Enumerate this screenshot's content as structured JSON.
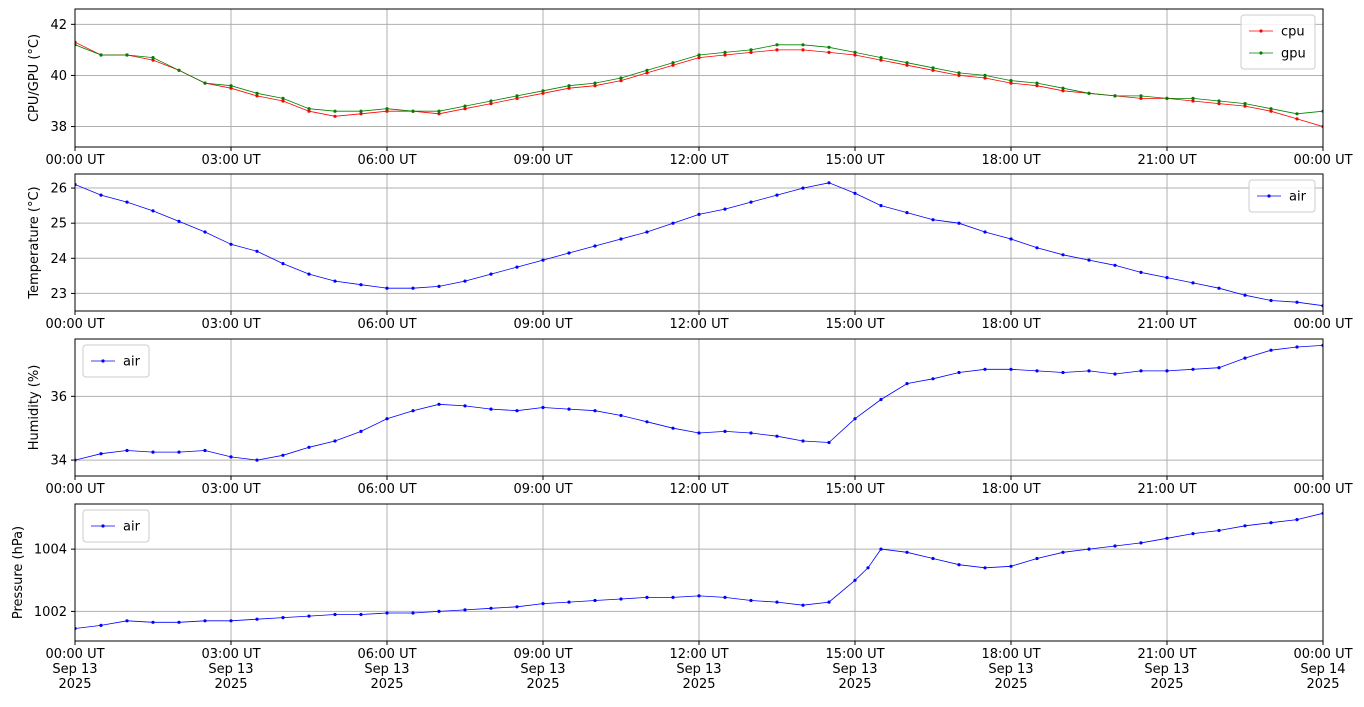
{
  "chart_data": [
    {
      "type": "line",
      "ylabel": "CPU/GPU (°C)",
      "ylim": [
        37.2,
        42.6
      ],
      "yticks": [
        38,
        40,
        42
      ],
      "x_range": [
        "2025-09-13 00:00 UT",
        "2025-09-14 00:00 UT"
      ],
      "x_ticks": [
        "00:00 UT",
        "03:00 UT",
        "06:00 UT",
        "09:00 UT",
        "12:00 UT",
        "15:00 UT",
        "18:00 UT",
        "21:00 UT",
        "00:00 UT"
      ],
      "grid": true,
      "legend": "upper right",
      "series": [
        {
          "name": "cpu",
          "color": "#ff0000",
          "hours": [
            0,
            0.5,
            1,
            1.5,
            2,
            2.5,
            3,
            3.5,
            4,
            4.5,
            5,
            5.5,
            6,
            6.5,
            7,
            7.5,
            8,
            8.5,
            9,
            9.5,
            10,
            10.5,
            11,
            11.5,
            12,
            12.5,
            13,
            13.5,
            14,
            14.5,
            15,
            15.5,
            16,
            16.5,
            17,
            17.5,
            18,
            18.5,
            19,
            19.5,
            20,
            20.5,
            21,
            21.5,
            22,
            22.5,
            23,
            23.5,
            24
          ],
          "values": [
            41.3,
            40.8,
            40.8,
            40.6,
            40.2,
            39.7,
            39.5,
            39.2,
            39.0,
            38.6,
            38.4,
            38.5,
            38.6,
            38.6,
            38.5,
            38.7,
            38.9,
            39.1,
            39.3,
            39.5,
            39.6,
            39.8,
            40.1,
            40.4,
            40.7,
            40.8,
            40.9,
            41.0,
            41.0,
            40.9,
            40.8,
            40.6,
            40.4,
            40.2,
            40.0,
            39.9,
            39.7,
            39.6,
            39.4,
            39.3,
            39.2,
            39.1,
            39.1,
            39.0,
            38.9,
            38.8,
            38.6,
            38.3,
            38.0
          ]
        },
        {
          "name": "gpu",
          "color": "#008000",
          "hours": [
            0,
            0.5,
            1,
            1.5,
            2,
            2.5,
            3,
            3.5,
            4,
            4.5,
            5,
            5.5,
            6,
            6.5,
            7,
            7.5,
            8,
            8.5,
            9,
            9.5,
            10,
            10.5,
            11,
            11.5,
            12,
            12.5,
            13,
            13.5,
            14,
            14.5,
            15,
            15.5,
            16,
            16.5,
            17,
            17.5,
            18,
            18.5,
            19,
            19.5,
            20,
            20.5,
            21,
            21.5,
            22,
            22.5,
            23,
            23.5,
            24
          ],
          "values": [
            41.2,
            40.8,
            40.8,
            40.7,
            40.2,
            39.7,
            39.6,
            39.3,
            39.1,
            38.7,
            38.6,
            38.6,
            38.7,
            38.6,
            38.6,
            38.8,
            39.0,
            39.2,
            39.4,
            39.6,
            39.7,
            39.9,
            40.2,
            40.5,
            40.8,
            40.9,
            41.0,
            41.2,
            41.2,
            41.1,
            40.9,
            40.7,
            40.5,
            40.3,
            40.1,
            40.0,
            39.8,
            39.7,
            39.5,
            39.3,
            39.2,
            39.2,
            39.1,
            39.1,
            39.0,
            38.9,
            38.7,
            38.5,
            38.6
          ]
        }
      ]
    },
    {
      "type": "line",
      "ylabel": "Temperature (°C)",
      "ylim": [
        22.5,
        26.4
      ],
      "yticks": [
        23,
        24,
        25,
        26
      ],
      "x_range": [
        "2025-09-13 00:00 UT",
        "2025-09-14 00:00 UT"
      ],
      "x_ticks": [
        "00:00 UT",
        "03:00 UT",
        "06:00 UT",
        "09:00 UT",
        "12:00 UT",
        "15:00 UT",
        "18:00 UT",
        "21:00 UT",
        "00:00 UT"
      ],
      "grid": true,
      "legend": "upper right",
      "series": [
        {
          "name": "air",
          "color": "#0000ff",
          "hours": [
            0,
            0.5,
            1,
            1.5,
            2,
            2.5,
            3,
            3.5,
            4,
            4.5,
            5,
            5.5,
            6,
            6.5,
            7,
            7.5,
            8,
            8.5,
            9,
            9.5,
            10,
            10.5,
            11,
            11.5,
            12,
            12.5,
            13,
            13.5,
            14,
            14.5,
            15,
            15.5,
            16,
            16.5,
            17,
            17.5,
            18,
            18.5,
            19,
            19.5,
            20,
            20.5,
            21,
            21.5,
            22,
            22.5,
            23,
            23.5,
            24
          ],
          "values": [
            26.1,
            25.8,
            25.6,
            25.35,
            25.05,
            24.75,
            24.4,
            24.2,
            23.85,
            23.55,
            23.35,
            23.25,
            23.15,
            23.15,
            23.2,
            23.35,
            23.55,
            23.75,
            23.95,
            24.15,
            24.35,
            24.55,
            24.75,
            25.0,
            25.25,
            25.4,
            25.6,
            25.8,
            26.0,
            26.15,
            25.85,
            25.5,
            25.3,
            25.1,
            25.0,
            24.75,
            24.55,
            24.3,
            24.1,
            23.95,
            23.8,
            23.6,
            23.45,
            23.3,
            23.15,
            22.95,
            22.8,
            22.75,
            22.65
          ]
        }
      ]
    },
    {
      "type": "line",
      "ylabel": "Humidity (%)",
      "ylim": [
        33.5,
        37.8
      ],
      "yticks": [
        34,
        36
      ],
      "x_range": [
        "2025-09-13 00:00 UT",
        "2025-09-14 00:00 UT"
      ],
      "x_ticks": [
        "00:00 UT",
        "03:00 UT",
        "06:00 UT",
        "09:00 UT",
        "12:00 UT",
        "15:00 UT",
        "18:00 UT",
        "21:00 UT",
        "00:00 UT"
      ],
      "grid": true,
      "legend": "upper left",
      "series": [
        {
          "name": "air",
          "color": "#0000ff",
          "hours": [
            0,
            0.5,
            1,
            1.5,
            2,
            2.5,
            3,
            3.5,
            4,
            4.5,
            5,
            5.5,
            6,
            6.5,
            7,
            7.5,
            8,
            8.5,
            9,
            9.5,
            10,
            10.5,
            11,
            11.5,
            12,
            12.5,
            13,
            13.5,
            14,
            14.5,
            15,
            15.5,
            16,
            16.5,
            17,
            17.5,
            18,
            18.5,
            19,
            19.5,
            20,
            20.5,
            21,
            21.5,
            22,
            22.5,
            23,
            23.5,
            24
          ],
          "values": [
            34.0,
            34.2,
            34.3,
            34.25,
            34.25,
            34.3,
            34.1,
            34.0,
            34.15,
            34.4,
            34.6,
            34.9,
            35.3,
            35.55,
            35.75,
            35.7,
            35.6,
            35.55,
            35.65,
            35.6,
            35.55,
            35.4,
            35.2,
            35.0,
            34.85,
            34.9,
            34.85,
            34.75,
            34.6,
            34.55,
            35.3,
            35.9,
            36.4,
            36.55,
            36.75,
            36.85,
            36.85,
            36.8,
            36.75,
            36.8,
            36.7,
            36.8,
            36.8,
            36.85,
            36.9,
            37.2,
            37.45,
            37.55,
            37.6
          ]
        }
      ]
    },
    {
      "type": "line",
      "ylabel": "Pressure (hPa)",
      "ylim": [
        1001.05,
        1005.45
      ],
      "yticks": [
        1002,
        1004
      ],
      "x_range": [
        "2025-09-13 00:00 UT",
        "2025-09-14 00:00 UT"
      ],
      "x_ticks": [
        "00:00 UT\nSep 13\n2025",
        "03:00 UT\nSep 13\n2025",
        "06:00 UT\nSep 13\n2025",
        "09:00 UT\nSep 13\n2025",
        "12:00 UT\nSep 13\n2025",
        "15:00 UT\nSep 13\n2025",
        "18:00 UT\nSep 13\n2025",
        "21:00 UT\nSep 13\n2025",
        "00:00 UT\nSep 14\n2025"
      ],
      "grid": true,
      "legend": "upper left",
      "series": [
        {
          "name": "air",
          "color": "#0000ff",
          "hours": [
            0,
            0.5,
            1,
            1.5,
            2,
            2.5,
            3,
            3.5,
            4,
            4.5,
            5,
            5.5,
            6,
            6.5,
            7,
            7.5,
            8,
            8.5,
            9,
            9.5,
            10,
            10.5,
            11,
            11.5,
            12,
            12.5,
            13,
            13.5,
            14,
            14.5,
            15,
            15.25,
            15.5,
            16,
            16.5,
            17,
            17.5,
            18,
            18.5,
            19,
            19.5,
            20,
            20.5,
            21,
            21.5,
            22,
            22.5,
            23,
            23.5,
            24
          ],
          "values": [
            1001.45,
            1001.55,
            1001.7,
            1001.65,
            1001.65,
            1001.7,
            1001.7,
            1001.75,
            1001.8,
            1001.85,
            1001.9,
            1001.9,
            1001.95,
            1001.95,
            1002.0,
            1002.05,
            1002.1,
            1002.15,
            1002.25,
            1002.3,
            1002.35,
            1002.4,
            1002.45,
            1002.45,
            1002.5,
            1002.45,
            1002.35,
            1002.3,
            1002.2,
            1002.3,
            1003.0,
            1003.4,
            1004.0,
            1003.9,
            1003.7,
            1003.5,
            1003.4,
            1003.45,
            1003.7,
            1003.9,
            1004.0,
            1004.1,
            1004.2,
            1004.35,
            1004.5,
            1004.6,
            1004.75,
            1004.85,
            1004.95,
            1005.15
          ]
        }
      ]
    }
  ]
}
